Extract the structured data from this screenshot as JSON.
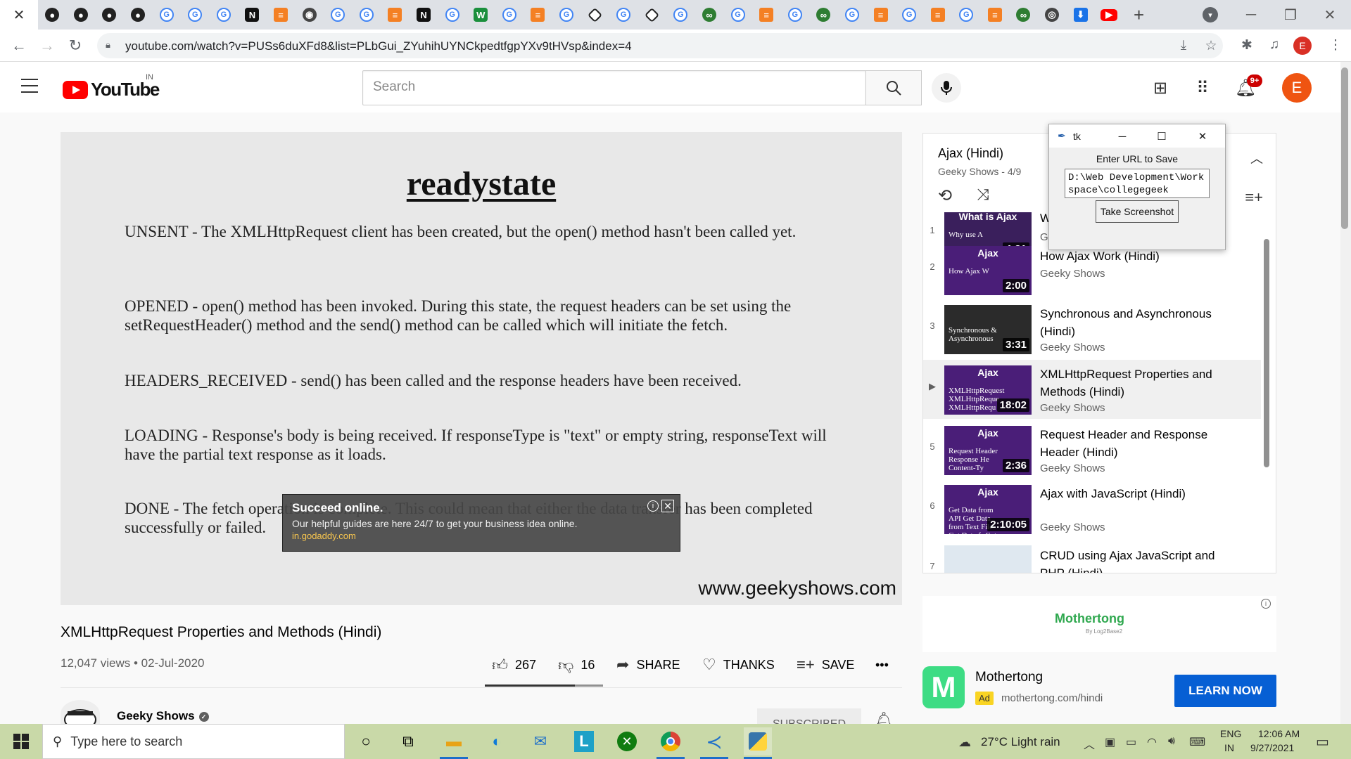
{
  "browser": {
    "active_tab_close": "✕",
    "favicons": [
      "github",
      "github",
      "github",
      "github",
      "google",
      "google",
      "google",
      "notion",
      "stackoverflow",
      "world",
      "google",
      "google",
      "stackoverflow",
      "notion",
      "google",
      "w",
      "google",
      "stackoverflow",
      "google",
      "diamond",
      "google",
      "diamond",
      "google",
      "green",
      "google",
      "stackoverflow",
      "google",
      "green",
      "google",
      "stackoverflow",
      "google",
      "stackoverflow",
      "google",
      "stackoverflow",
      "green",
      "chrome",
      "download",
      "youtube"
    ],
    "favicon_glyphs": {
      "github": "●",
      "google": "G",
      "notion": "N",
      "stackoverflow": "≡",
      "world": "◉",
      "w": "W",
      "diamond": "",
      "green": "∞",
      "chrome": "◎",
      "download": "⬇",
      "youtube": "▶"
    },
    "new_tab": "+",
    "url": "youtube.com/watch?v=PUSs6duXFd8&list=PLbGui_ZYuhihUYNCkpedtfgpYXv9tHVsp&index=4",
    "profile_initial": "E",
    "window_controls": {
      "minimize": "─",
      "maximize": "❐",
      "close": "✕"
    }
  },
  "youtube": {
    "logo_text": "YouTube",
    "country": "IN",
    "search_placeholder": "Search",
    "notification_count": "9+",
    "avatar_initial": "E"
  },
  "slide": {
    "title": "readystate",
    "paragraphs": [
      "UNSENT - The XMLHttpRequest client has been created, but the open() method hasn't been called yet.",
      "OPENED - open() method has been invoked. During this state, the request headers can be set using the setRequestHeader() method and the send() method can be called which will initiate the fetch.",
      "HEADERS_RECEIVED - send() has been called and the response headers have been received.",
      "LOADING - Response's body is being received. If responseType is \"text\" or empty string, responseText will have the partial text response as it loads.",
      "DONE - The fetch operation is complete. This could mean that either the data transfer has been completed successfully or failed."
    ],
    "watermark": "www.geekyshows.com"
  },
  "video_ad": {
    "title": "Succeed online.",
    "description": "Our helpful guides are here 24/7 to get your business idea online.",
    "link": "in.godaddy.com",
    "info": "i",
    "close": "✕"
  },
  "video": {
    "title": "XMLHttpRequest Properties and Methods (Hindi)",
    "meta": "12,047 views • 02-Jul-2020",
    "likes": "267",
    "dislikes": "16",
    "like_ratio": 0.76,
    "share": "SHARE",
    "thanks": "THANKS",
    "save": "SAVE",
    "more": "•••",
    "channel": "Geeky Shows",
    "subscribe_label": "SUBSCRIBED"
  },
  "playlist": {
    "title": "Ajax (Hindi)",
    "subtitle": "Geeky Shows - 4/9",
    "items": [
      {
        "index": "1",
        "title": "What is Ajax (Hindi)",
        "channel": "Geeky Shows",
        "duration": "4:31",
        "thumb_main": "What is Ajax",
        "thumb_sub": "Why use A",
        "color": "#3a1f5c"
      },
      {
        "index": "2",
        "title": "How Ajax Work (Hindi)",
        "channel": "Geeky Shows",
        "duration": "2:00",
        "thumb_main": "Ajax",
        "thumb_sub": "How Ajax W",
        "color": "#4a1e78"
      },
      {
        "index": "3",
        "title": "Synchronous and Asynchronous (Hindi)",
        "channel": "Geeky Shows",
        "duration": "3:31",
        "thumb_main": "",
        "thumb_sub": "Synchronous & Asynchronous",
        "color": "#2b2b2b"
      },
      {
        "index": "▶",
        "title": "XMLHttpRequest Properties and Methods (Hindi)",
        "channel": "Geeky Shows",
        "duration": "18:02",
        "thumb_main": "Ajax",
        "thumb_sub": "XMLHttpRequest XMLHttpReque XMLHttpRequ",
        "color": "#4a1e78"
      },
      {
        "index": "5",
        "title": "Request Header and Response Header (Hindi)",
        "channel": "Geeky Shows",
        "duration": "2:36",
        "thumb_main": "Ajax",
        "thumb_sub": "Request Header Response He Content-Ty",
        "color": "#4a1e78"
      },
      {
        "index": "6",
        "title": "Ajax with JavaScript (Hindi)",
        "channel": "Geeky Shows",
        "duration": "2:10:05",
        "thumb_main": "Ajax",
        "thumb_sub": "Get Data from API Get Data from Text File Get Data fr Get Data f",
        "color": "#4a1e78"
      },
      {
        "index": "7",
        "title": "CRUD using Ajax JavaScript and PHP (Hindi)",
        "channel": "",
        "duration": "",
        "thumb_main": "",
        "thumb_sub": "",
        "color": "#dfe8f0"
      }
    ]
  },
  "tk_dialog": {
    "title": "tk",
    "label": "Enter URL to Save",
    "entry_value": "D:\\Web Development\\Workspace\\collegegeek",
    "button": "Take Screenshot"
  },
  "side_ad": {
    "banner_logo": "Mothertong",
    "banner_sub": "By Log2Base2",
    "name": "Mothertong",
    "badge": "Ad",
    "domain": "mothertong.com/hindi",
    "cta": "LEARN NOW",
    "icon_letter": "M"
  },
  "taskbar": {
    "search_placeholder": "Type here to search",
    "weather": "27°C  Light rain",
    "lang_top": "ENG",
    "lang_bottom": "IN",
    "time": "12:06 AM",
    "date": "9/27/2021"
  }
}
